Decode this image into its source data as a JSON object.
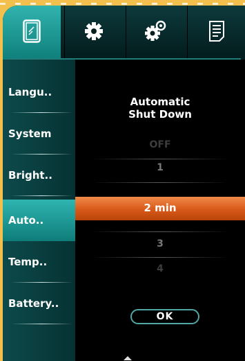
{
  "tabs": [
    {
      "name": "display-tab",
      "icon": "phone-screen-icon",
      "active": true
    },
    {
      "name": "settings-tab",
      "icon": "gear-icon",
      "active": false
    },
    {
      "name": "advanced-settings-tab",
      "icon": "gears-icon",
      "active": false
    },
    {
      "name": "info-tab",
      "icon": "document-icon",
      "active": false
    }
  ],
  "sidebar": {
    "items": [
      {
        "label": "Langu.."
      },
      {
        "label": "System"
      },
      {
        "label": "Bright.."
      },
      {
        "label": "Auto..",
        "active": true
      },
      {
        "label": "Temp.."
      },
      {
        "label": "Battery.."
      }
    ]
  },
  "panel": {
    "title": "Automatic\nShut Down",
    "options": [
      "OFF",
      "1",
      "2  min",
      "3",
      "4"
    ],
    "selected": "2  min",
    "ok_label": "OK"
  },
  "colors": {
    "accent": "#1f9e9a",
    "selection": "#d8591a",
    "background": "#f4c04d"
  }
}
